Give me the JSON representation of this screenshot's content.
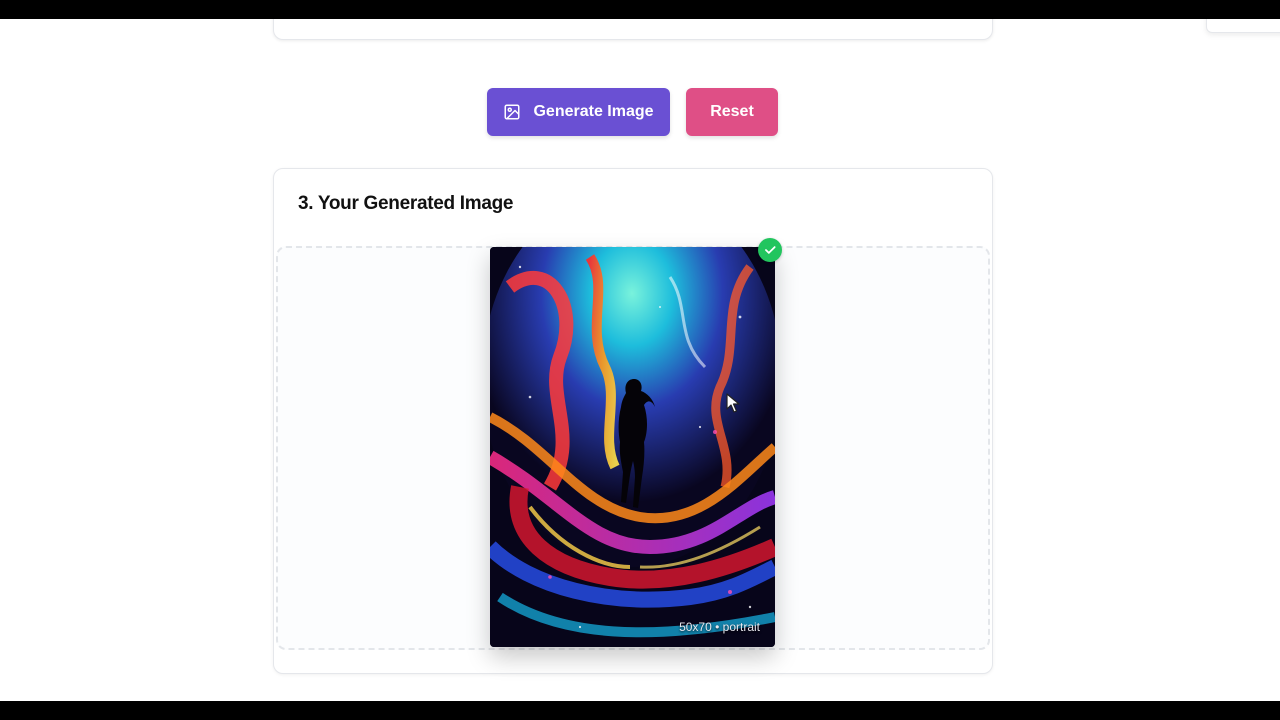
{
  "actions": {
    "generate_label": "Generate Image",
    "reset_label": "Reset"
  },
  "result": {
    "title": "3. Your Generated Image",
    "image_alt": "Silhouette of a woman standing in a vibrant swirling cosmic nebula",
    "image_meta": "50x70 • portrait",
    "status": "success"
  },
  "colors": {
    "generate_button": "#6a50d3",
    "reset_button": "#df4f86",
    "success_badge": "#22c55e"
  },
  "icons": {
    "generate": "image-icon",
    "status": "check-icon",
    "pointer": "mouse-cursor-icon"
  }
}
